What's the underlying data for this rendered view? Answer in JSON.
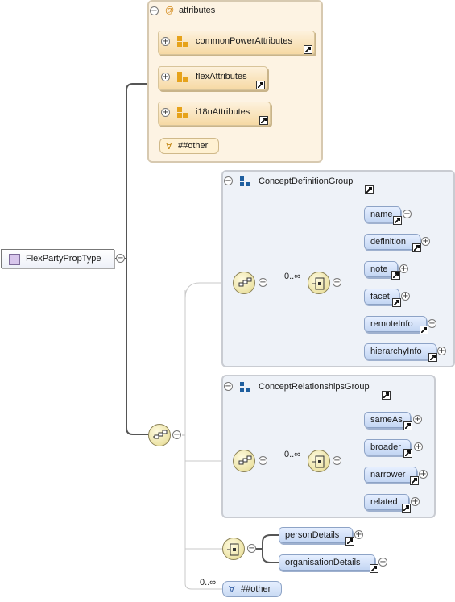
{
  "root": {
    "label": "FlexPartyPropType"
  },
  "attributes_panel": {
    "title": "attributes",
    "at_symbol": "@",
    "items": [
      {
        "label": "commonPowerAttributes"
      },
      {
        "label": "flexAttributes"
      },
      {
        "label": "i18nAttributes"
      }
    ],
    "other": {
      "symbol": "∀",
      "label": "##other"
    }
  },
  "concept_definition_group": {
    "title": "ConceptDefinitionGroup",
    "cardinality": "0..∞",
    "elements": [
      "name",
      "definition",
      "note",
      "facet",
      "remoteInfo",
      "hierarchyInfo"
    ]
  },
  "concept_relationships_group": {
    "title": "ConceptRelationshipsGroup",
    "cardinality": "0..∞",
    "elements": [
      "sameAs",
      "broader",
      "narrower",
      "related"
    ]
  },
  "choice_group": {
    "elements": [
      "personDetails",
      "organisationDetails"
    ]
  },
  "any_element": {
    "cardinality": "0..∞",
    "symbol": "∀",
    "label": "##other"
  },
  "toggles": {
    "expanded": "−",
    "collapsed": "+"
  },
  "colors": {
    "attr_panel_bg": "#fdf3e3",
    "group_panel_bg": "#eef2f8",
    "element_fill": "#c3d6f3",
    "compositor_fill": "#ece3a6",
    "root_square": "#d8c6ec",
    "group_icon": "#1f5f9f",
    "attr_icon": "#e6a21a"
  }
}
